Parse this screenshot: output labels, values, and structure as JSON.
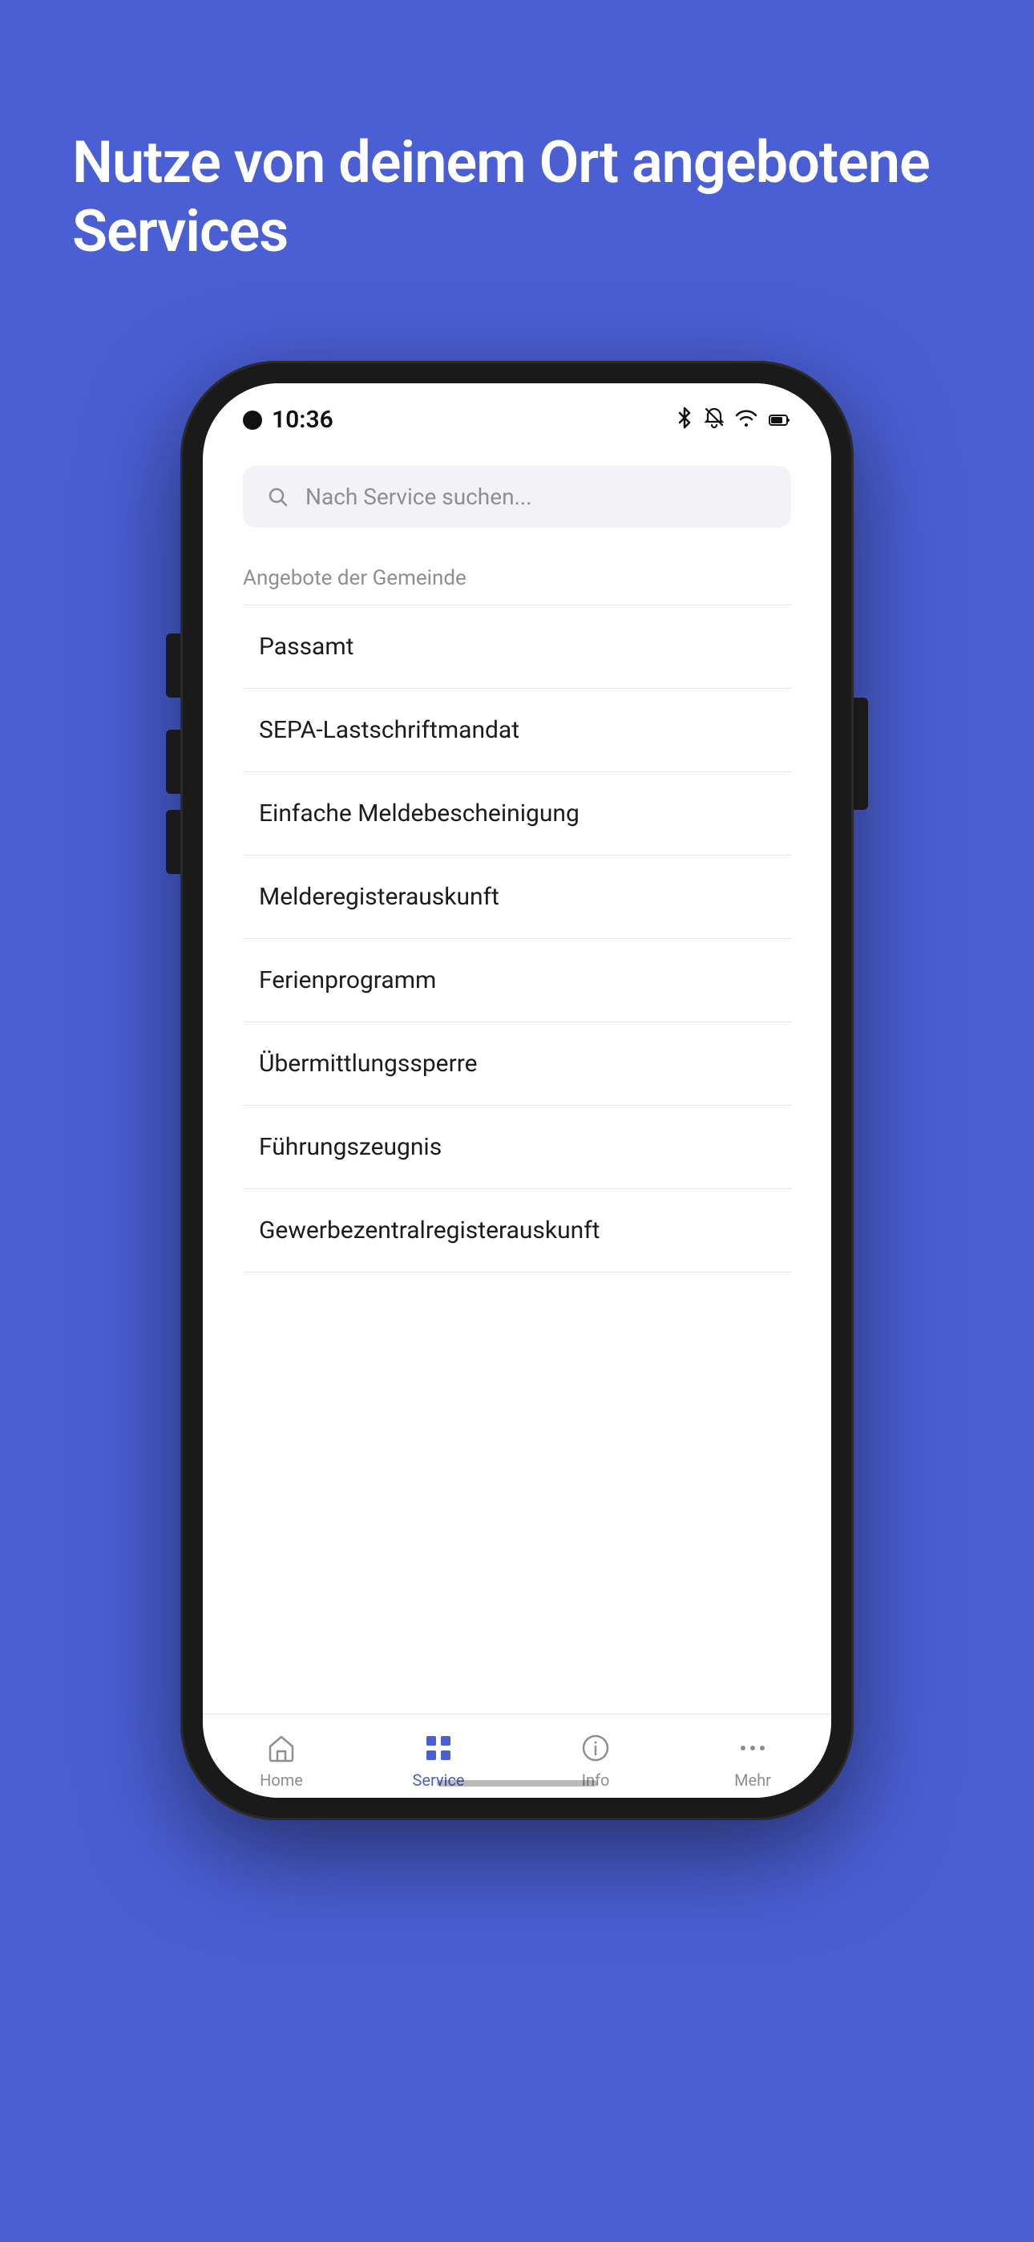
{
  "background_color": "#4a5fd4",
  "hero": {
    "title": "Nutze von deinem Ort angebotene Services"
  },
  "phone": {
    "status_bar": {
      "time": "10:36"
    },
    "search": {
      "placeholder": "Nach Service suchen..."
    },
    "section_title": "Angebote der Gemeinde",
    "services": [
      {
        "label": "Passamt"
      },
      {
        "label": "SEPA-Lastschriftmandat"
      },
      {
        "label": "Einfache Meldebescheinigung"
      },
      {
        "label": "Melderegisterauskunft"
      },
      {
        "label": "Ferienprogramm"
      },
      {
        "label": "Übermittlungssperre"
      },
      {
        "label": "Führungszeugnis"
      },
      {
        "label": "Gewerbezentralregisterauskunft"
      }
    ],
    "bottom_nav": {
      "items": [
        {
          "label": "Home",
          "icon": "home-icon",
          "active": false
        },
        {
          "label": "Service",
          "icon": "service-icon",
          "active": true
        },
        {
          "label": "Info",
          "icon": "info-icon",
          "active": false
        },
        {
          "label": "Mehr",
          "icon": "more-icon",
          "active": false
        }
      ]
    }
  }
}
